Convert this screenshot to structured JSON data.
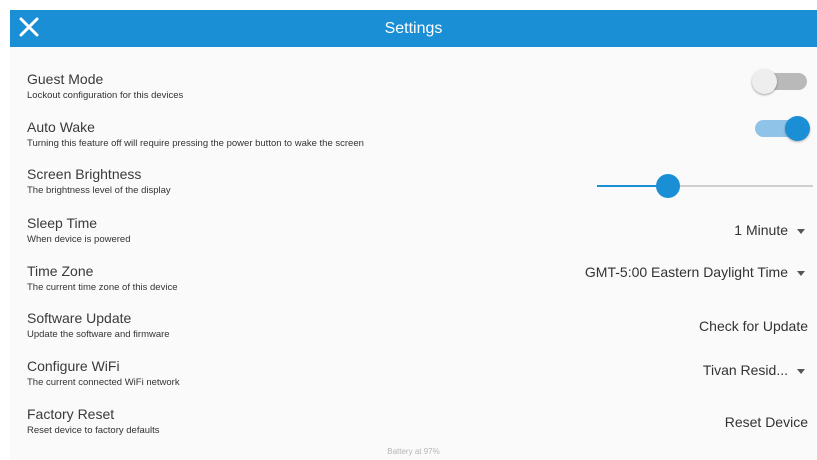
{
  "header": {
    "title": "Settings",
    "close_icon": "close-icon",
    "color": "#1a8fd6"
  },
  "settings": {
    "guest_mode": {
      "label": "Guest Mode",
      "description": "Lockout configuration for this devices",
      "enabled": false
    },
    "auto_wake": {
      "label": "Auto Wake",
      "description": "Turning this feature off will require pressing the power button to wake the screen",
      "enabled": true
    },
    "screen_brightness": {
      "label": "Screen Brightness",
      "description": "The brightness level of the display",
      "level_fraction": 0.33
    },
    "sleep_time": {
      "label": "Sleep Time",
      "description": "When device is powered",
      "value": "1 Minute"
    },
    "time_zone": {
      "label": "Time Zone",
      "description": "The current time zone of this device",
      "value": "GMT-5:00 Eastern Daylight Time"
    },
    "software_update": {
      "label": "Software Update",
      "description": "Update the software and firmware",
      "action": "Check for Update"
    },
    "configure_wifi": {
      "label": "Configure WiFi",
      "description": "The current connected WiFi network",
      "value": "Tivan Resid..."
    },
    "factory_reset": {
      "label": "Factory Reset",
      "description": "Reset device to factory defaults",
      "action": "Reset Device"
    }
  },
  "footer": {
    "battery": "Battery at 97%"
  }
}
